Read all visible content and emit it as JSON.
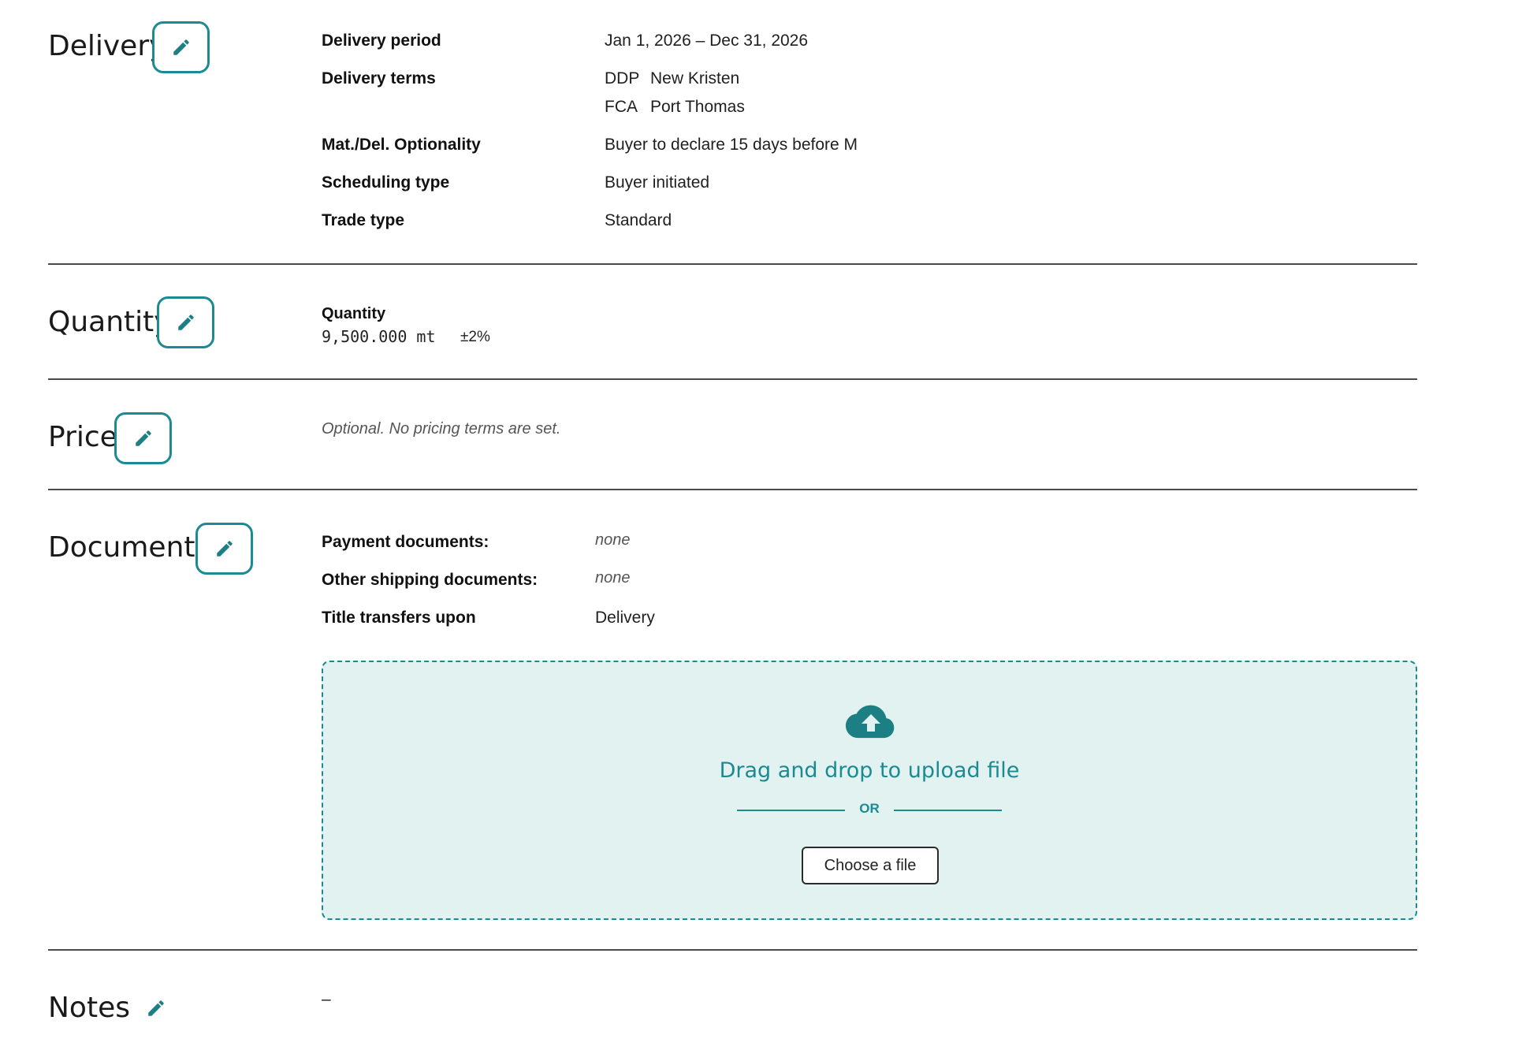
{
  "delivery": {
    "title": "Delivery",
    "rows": [
      {
        "label": "Delivery period",
        "value": "Jan 1, 2026 – Dec 31, 2026"
      },
      {
        "label": "Delivery terms",
        "terms": [
          {
            "incoterm": "DDP",
            "place": "New Kristen"
          },
          {
            "incoterm": "FCA",
            "place": "Port Thomas"
          }
        ]
      },
      {
        "label": "Mat./Del. Optionality",
        "value": "Buyer to declare 15 days before M"
      },
      {
        "label": "Scheduling type",
        "value": "Buyer initiated"
      },
      {
        "label": "Trade type",
        "value": "Standard"
      }
    ]
  },
  "quantity": {
    "title": "Quantity",
    "label": "Quantity",
    "amount": "9,500.000 mt",
    "tolerance": "±2%"
  },
  "price": {
    "title": "Price",
    "note": "Optional. No pricing terms are set."
  },
  "documents": {
    "title": "Documents",
    "rows": [
      {
        "label": "Payment documents:",
        "value": "none"
      },
      {
        "label": "Other shipping documents:",
        "value": "none"
      },
      {
        "label": "Title transfers upon",
        "value": "Delivery"
      }
    ],
    "upload": {
      "icon": "cloud-upload-icon",
      "title": "Drag and drop to upload file",
      "or_text": "OR",
      "button_label": "Choose a file"
    }
  },
  "notes": {
    "title": "Notes",
    "value": "–"
  },
  "colors": {
    "accent": "#1b8a91",
    "dropzone_bg": "#e1f2f1",
    "divider": "#4a4a4a"
  }
}
